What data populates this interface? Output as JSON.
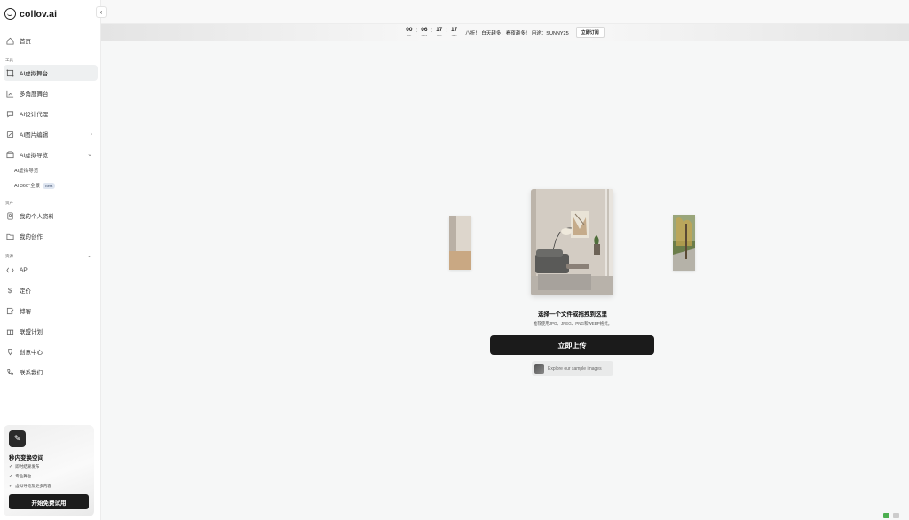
{
  "app": {
    "logo_text": "collov.ai"
  },
  "sidebar": {
    "home": "首页",
    "section_tools": "工具",
    "tools": [
      {
        "label": "AI虚拟舞台",
        "active": true
      },
      {
        "label": "多角度舞台"
      },
      {
        "label": "AI设计代理"
      },
      {
        "label": "AI图片编辑"
      },
      {
        "label": "AI虚拟导览"
      }
    ],
    "sub_items": [
      {
        "label": "AI虚拟导览"
      },
      {
        "label": "AI 360°全景",
        "badge": "Beta"
      }
    ],
    "section_assets": "资产",
    "assets": [
      {
        "label": "我的个人资料"
      },
      {
        "label": "我的创作"
      }
    ],
    "section_resources": "资源",
    "resources": [
      {
        "label": "API"
      },
      {
        "label": "定价"
      },
      {
        "label": "博客"
      },
      {
        "label": "联盟计划"
      },
      {
        "label": "创意中心"
      },
      {
        "label": "联系我们"
      }
    ],
    "promo": {
      "title": "秒内变换空间",
      "features": [
        "即时结果发布",
        "专业舞台",
        "虚拟导览及更多内容"
      ],
      "cta": "开始免费试用"
    }
  },
  "banner": {
    "countdown": [
      {
        "value": "00",
        "unit": "DAY"
      },
      {
        "value": "06",
        "unit": "HRS"
      },
      {
        "value": "17",
        "unit": "MIN"
      },
      {
        "value": "17",
        "unit": "SEC"
      }
    ],
    "text": "八折！ 白天越多，看夜越多！ 用途：SUNNY25",
    "button": "立即订阅"
  },
  "upload": {
    "title": "选择一个文件或拖拽到这里",
    "hint": "推荐使用JPG、JPEG、PNG和WEBP格式。",
    "button": "立即上传",
    "sample": "Explore our sample images"
  }
}
